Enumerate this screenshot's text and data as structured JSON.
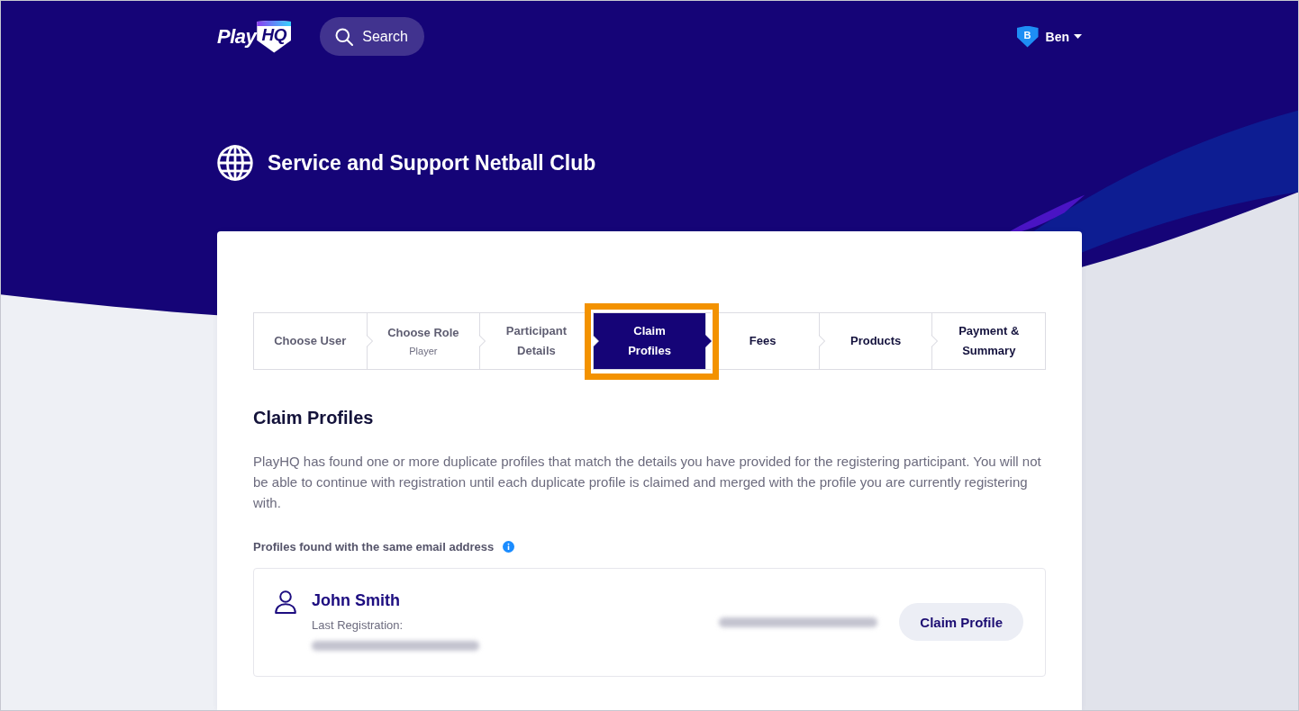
{
  "header": {
    "logo": {
      "text": "Play",
      "badge_text": "HQ"
    },
    "search": {
      "label": "Search"
    },
    "user": {
      "initial": "B",
      "name": "Ben"
    }
  },
  "club": {
    "name": "Service and Support Netball Club"
  },
  "stepper": {
    "steps": [
      {
        "label": "Choose User",
        "completed": true,
        "selected": false,
        "highlighted": false
      },
      {
        "label": "Choose Role",
        "sublabel": "Player",
        "completed": true,
        "selected": false,
        "highlighted": false
      },
      {
        "label": "Participant Details",
        "completed": true,
        "selected": false,
        "highlighted": false
      },
      {
        "label": "Claim Profiles",
        "completed": false,
        "selected": true,
        "highlighted": true
      },
      {
        "label": "Fees",
        "completed": false,
        "selected": false,
        "highlighted": false
      },
      {
        "label": "Products",
        "completed": false,
        "selected": false,
        "highlighted": false
      },
      {
        "label": "Payment & Summary",
        "completed": false,
        "selected": false,
        "highlighted": false
      }
    ]
  },
  "section": {
    "title": "Claim Profiles",
    "description": "PlayHQ has found one or more duplicate profiles that match the details you have provided for the registering participant. You will not be able to continue with registration until each duplicate profile is claimed and merged with the profile you are currently registering with.",
    "subheading": "Profiles found with the same email address"
  },
  "profiles": [
    {
      "name": "John Smith",
      "last_registration_label": "Last Registration:",
      "claim_button": "Claim Profile"
    }
  ]
}
